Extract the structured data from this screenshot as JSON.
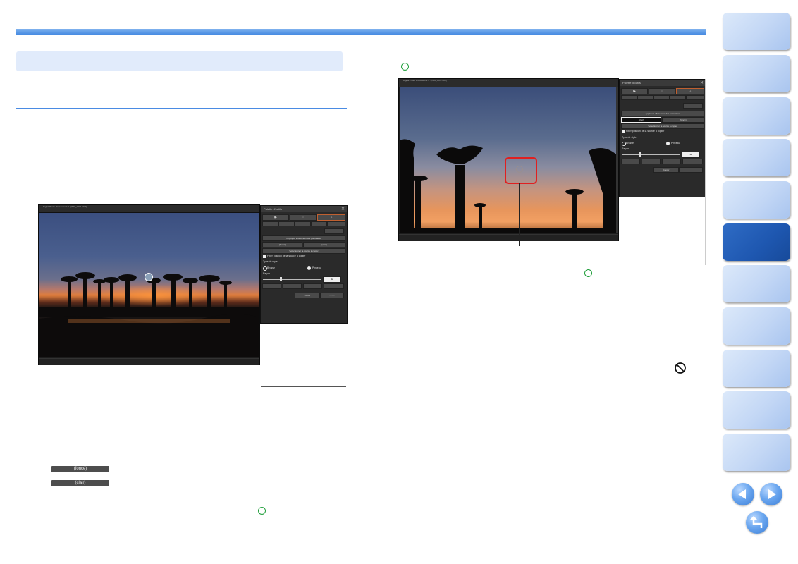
{
  "nav": {
    "tabs": [
      {
        "id": "tab-1",
        "active": false
      },
      {
        "id": "tab-2",
        "active": false
      },
      {
        "id": "tab-3",
        "active": false
      },
      {
        "id": "tab-4",
        "active": false
      },
      {
        "id": "tab-5",
        "active": false
      },
      {
        "id": "tab-6",
        "active": true
      },
      {
        "id": "tab-7",
        "active": false
      },
      {
        "id": "tab-8",
        "active": false
      },
      {
        "id": "tab-9",
        "active": false
      },
      {
        "id": "tab-10",
        "active": false
      },
      {
        "id": "tab-11",
        "active": false
      }
    ]
  },
  "screenshot_left": {
    "app_title": "Digital Photo Professional 4 - [IMG_0001.CR2]",
    "palette": {
      "title": "Palette d'outils",
      "apply_label": "Appliquer effacement des poussières",
      "btn_dark": "(foncé)",
      "btn_light": "(clair)",
      "select_source": "Sélectionner la source à copier",
      "fix_position": "Fixer position de la source à copier",
      "brush_type": "Type de style",
      "brush_thick": "Brosse",
      "brush_fine": "Pinceau",
      "radius": "Rayon",
      "radius_value": "32",
      "copy": "Copier",
      "undo": "Undo"
    }
  },
  "screenshot_right": {
    "app_title": "Digital Photo Professional 4 - [IMG_0001.CR2]",
    "palette": {
      "title": "Palette d'outils",
      "apply_label": "Appliquer effacement des poussières",
      "btn_dark": "(clair)",
      "btn_light": "(foncé)",
      "select_source": "Sélectionner la source à copier",
      "fix_position": "Fixer position de la source à copier",
      "brush_type": "Type de style",
      "brush_thick": "Brosse",
      "brush_fine": "Pinceau",
      "radius": "Rayon",
      "radius_value": "32",
      "copy": "Copier"
    }
  },
  "legend_buttons": {
    "dark": "(foncé)",
    "light": "(clair)"
  },
  "colors": {
    "accent_blue": "#3f86e0",
    "active_tab": "#1e57b0",
    "marker_green": "#1f9e3a",
    "highlight_red": "#e02020"
  }
}
